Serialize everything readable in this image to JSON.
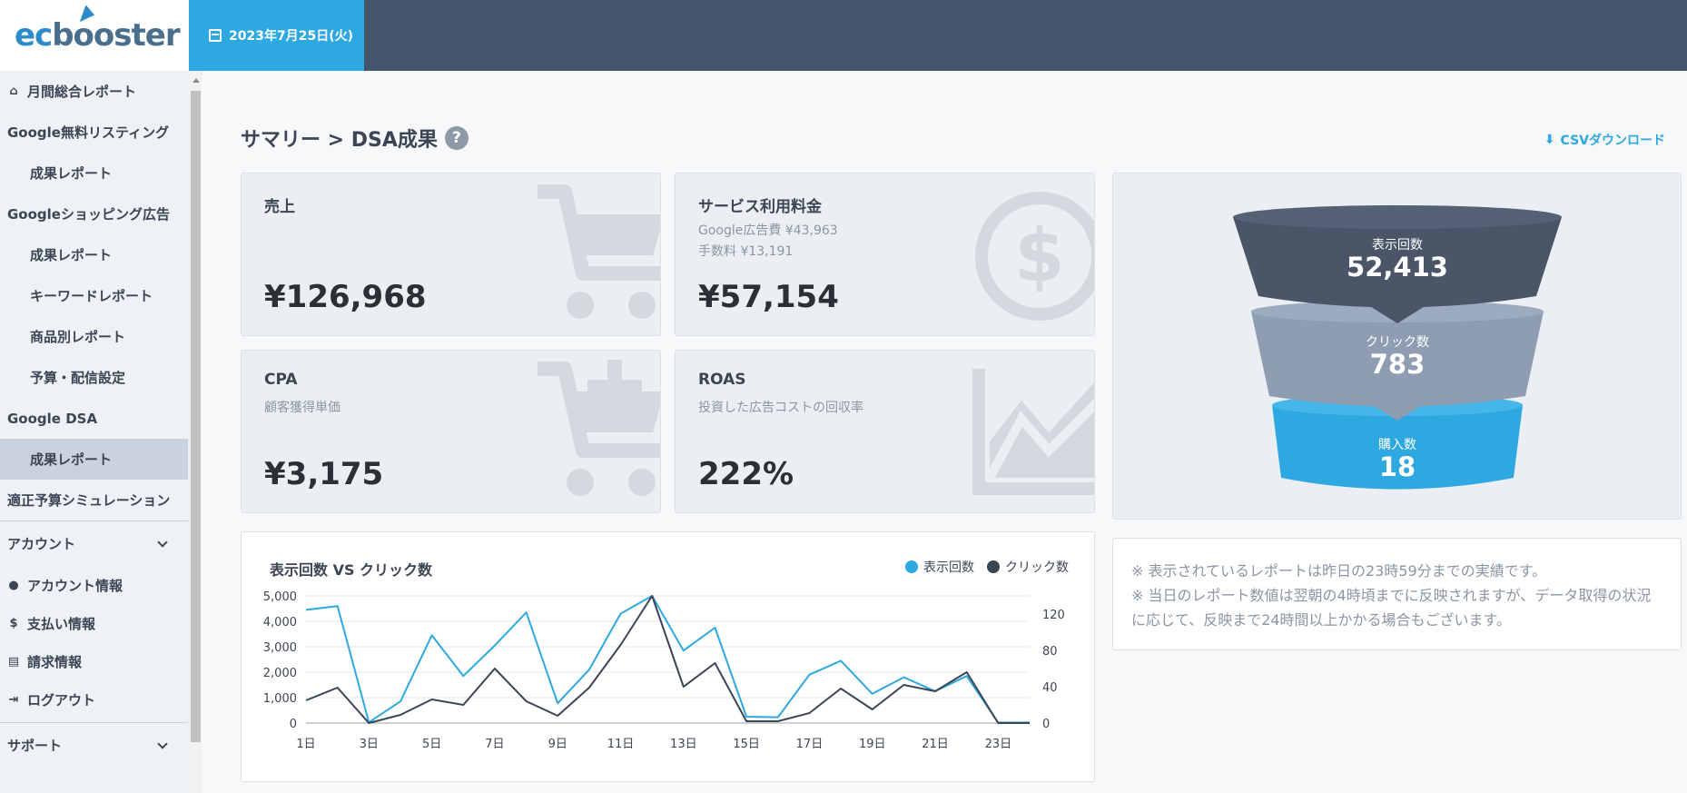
{
  "app": {
    "logo_ec": "ec",
    "logo_rest": "booster"
  },
  "header": {
    "date": "2023年7月25日(火)"
  },
  "sidebar": {
    "items": [
      {
        "label": "月間総合レポート",
        "icon": "home-icon",
        "type": "item"
      },
      {
        "label": "Google無料リスティング",
        "type": "item"
      },
      {
        "label": "成果レポート",
        "type": "sub"
      },
      {
        "label": "Googleショッピング広告",
        "type": "item"
      },
      {
        "label": "成果レポート",
        "type": "sub"
      },
      {
        "label": "キーワードレポート",
        "type": "sub"
      },
      {
        "label": "商品別レポート",
        "type": "sub"
      },
      {
        "label": "予算・配信設定",
        "type": "sub"
      },
      {
        "label": "Google DSA",
        "type": "item"
      },
      {
        "label": "成果レポート",
        "type": "sub",
        "active": true
      },
      {
        "label": "適正予算シミュレーション",
        "type": "item"
      }
    ],
    "account_group": "アカウント",
    "account_items": [
      {
        "label": "アカウント情報",
        "icon": "user-icon"
      },
      {
        "label": "支払い情報",
        "icon": "dollar-circle-icon"
      },
      {
        "label": "請求情報",
        "icon": "document-icon"
      },
      {
        "label": "ログアウト",
        "icon": "logout-icon"
      }
    ],
    "support_group": "サポート"
  },
  "page": {
    "title": "サマリー > DSA成果",
    "help": "?",
    "csv_label": "CSVダウンロード"
  },
  "cards": {
    "sales": {
      "label": "売上",
      "value": "¥126,968",
      "icon": "cart-icon"
    },
    "fee": {
      "label": "サービス利用料金",
      "desc1": "Google広告費 ¥43,963",
      "desc2": "手数料 ¥13,191",
      "value": "¥57,154",
      "icon": "dollar-circle-icon"
    },
    "cpa": {
      "label": "CPA",
      "desc": "顧客獲得単価",
      "value": "¥3,175",
      "icon": "cart-plus-icon"
    },
    "roas": {
      "label": "ROAS",
      "desc": "投資した広告コストの回収率",
      "value": "222%",
      "icon": "chart-area-icon"
    }
  },
  "funnel": {
    "impressions_label": "表示回数",
    "impressions": "52,413",
    "clicks_label": "クリック数",
    "clicks": "783",
    "purchases_label": "購入数",
    "purchases": "18",
    "colors": [
      "#4a5568",
      "#8e9db2",
      "#2ea8e0"
    ]
  },
  "notes": {
    "line1": "※ 表示されているレポートは昨日の23時59分までの実績です。",
    "line2": "※ 当日のレポート数値は翌朝の4時頃までに反映されますが、データ取得の状況に応じて、反映まで24時間以上かかる場合もございます。"
  },
  "chart_data": {
    "type": "line",
    "title": "表示回数 VS クリック数",
    "x": [
      "1日",
      "2日",
      "3日",
      "4日",
      "5日",
      "6日",
      "7日",
      "8日",
      "9日",
      "10日",
      "11日",
      "12日",
      "13日",
      "14日",
      "15日",
      "16日",
      "17日",
      "18日",
      "19日",
      "20日",
      "21日",
      "22日",
      "23日",
      "24日"
    ],
    "x_tick_labels": [
      "1日",
      "3日",
      "5日",
      "7日",
      "9日",
      "11日",
      "13日",
      "15日",
      "17日",
      "19日",
      "21日",
      "23日"
    ],
    "series": [
      {
        "name": "表示回数",
        "axis": "left",
        "color": "#2ea8e0",
        "values": [
          4450,
          4600,
          30,
          850,
          3450,
          1850,
          3050,
          4350,
          780,
          2100,
          4300,
          5000,
          2850,
          3750,
          250,
          230,
          1900,
          2450,
          1150,
          1800,
          1250,
          1850,
          20,
          20
        ]
      },
      {
        "name": "クリック数",
        "axis": "right",
        "color": "#3b4554",
        "values": [
          25,
          39,
          0,
          9,
          26,
          20,
          60,
          24,
          8,
          39,
          86,
          140,
          40,
          66,
          2,
          2,
          11,
          38,
          15,
          42,
          35,
          56,
          0,
          0
        ]
      }
    ],
    "y_left": {
      "ylim": [
        0,
        5000
      ],
      "ticks": [
        "0",
        "1,000",
        "2,000",
        "3,000",
        "4,000",
        "5,000"
      ]
    },
    "y_right": {
      "ylim": [
        0,
        140
      ],
      "ticks": [
        "0",
        "40",
        "80",
        "120"
      ]
    },
    "grid": true,
    "legend": "top-right"
  }
}
